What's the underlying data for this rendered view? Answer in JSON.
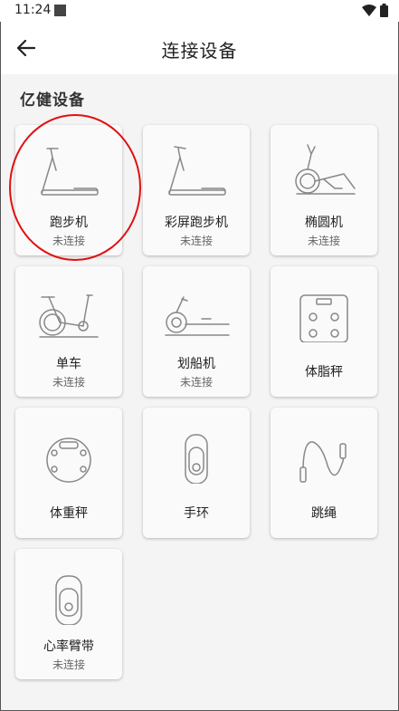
{
  "status_bar": {
    "time": "11:24"
  },
  "header": {
    "title": "连接设备"
  },
  "section": {
    "title": "亿健设备"
  },
  "devices": [
    {
      "name": "跑步机",
      "status": "未连接",
      "icon": "treadmill-icon"
    },
    {
      "name": "彩屏跑步机",
      "status": "未连接",
      "icon": "treadmill-icon"
    },
    {
      "name": "椭圆机",
      "status": "未连接",
      "icon": "elliptical-icon"
    },
    {
      "name": "单车",
      "status": "未连接",
      "icon": "bike-icon"
    },
    {
      "name": "划船机",
      "status": "未连接",
      "icon": "rowing-machine-icon"
    },
    {
      "name": "体脂秤",
      "status": "",
      "icon": "body-fat-scale-icon"
    },
    {
      "name": "体重秤",
      "status": "",
      "icon": "weight-scale-icon"
    },
    {
      "name": "手环",
      "status": "",
      "icon": "wristband-icon"
    },
    {
      "name": "跳绳",
      "status": "",
      "icon": "jump-rope-icon"
    },
    {
      "name": "心率臂带",
      "status": "未连接",
      "icon": "heart-rate-armband-icon"
    }
  ]
}
